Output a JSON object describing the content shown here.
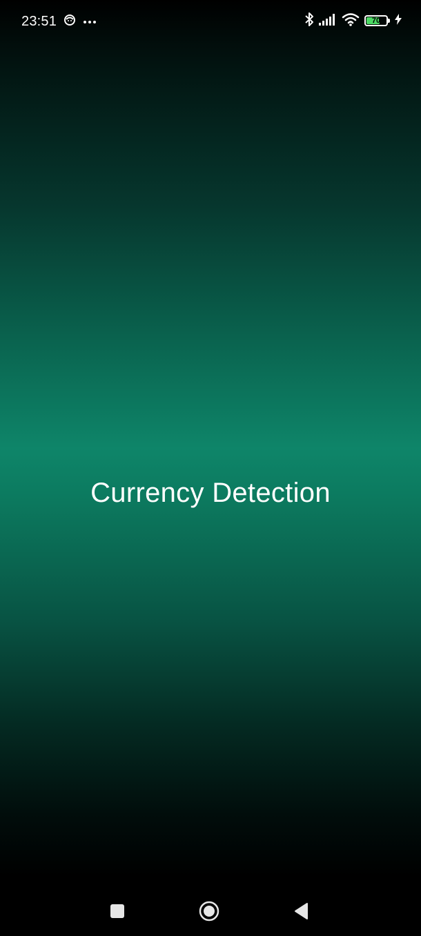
{
  "status_bar": {
    "time": "23:51",
    "battery_level": "70",
    "battery_percent": 70,
    "battery_color": "#4cd964",
    "charging": true,
    "left_icons": [
      "notification-app-icon",
      "more-dots-icon"
    ],
    "right_icons": [
      "bluetooth-icon",
      "signal-icon",
      "wifi-icon",
      "battery-icon",
      "charging-bolt-icon"
    ]
  },
  "main": {
    "title": "Currency Detection"
  },
  "theme": {
    "gradient_center": "#0e8569",
    "gradient_edge": "#000000",
    "text_color": "#ffffff"
  },
  "nav_bar": {
    "buttons": [
      "recents-button",
      "home-button",
      "back-button"
    ]
  }
}
